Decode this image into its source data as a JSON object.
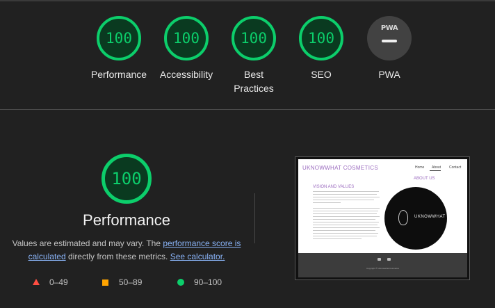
{
  "categories": [
    {
      "label": "Performance",
      "score": "100"
    },
    {
      "label": "Accessibility",
      "score": "100"
    },
    {
      "label": "Best Practices",
      "score": "100"
    },
    {
      "label": "SEO",
      "score": "100"
    }
  ],
  "pwa": {
    "badge": "PWA",
    "label": "PWA"
  },
  "main": {
    "score": "100",
    "title": "Performance",
    "desc_prefix": "Values are estimated and may vary. The ",
    "link_score": "performance score is calculated",
    "desc_middle": " directly from these metrics. ",
    "link_calculator": "See calculator."
  },
  "legend": [
    {
      "range": "0–49",
      "color": "#ff4e42"
    },
    {
      "range": "50–89",
      "color": "#ffa400"
    },
    {
      "range": "90–100",
      "color": "#0cce6b"
    }
  ],
  "thumbnail": {
    "brand": "UKNOWWHAT COSMETICS",
    "nav": [
      "Home",
      "About",
      "Contact"
    ],
    "about_heading": "ABOUT US",
    "vision_heading": "VISION AND VALUES",
    "logo_text": "UKNOWWHAT",
    "copyright": "Copyright © Uknowwhat Cosmetics"
  },
  "colors": {
    "pass": "#0cce6b",
    "average": "#ffa400",
    "fail": "#ff4e42",
    "link": "#8ab4f8"
  }
}
